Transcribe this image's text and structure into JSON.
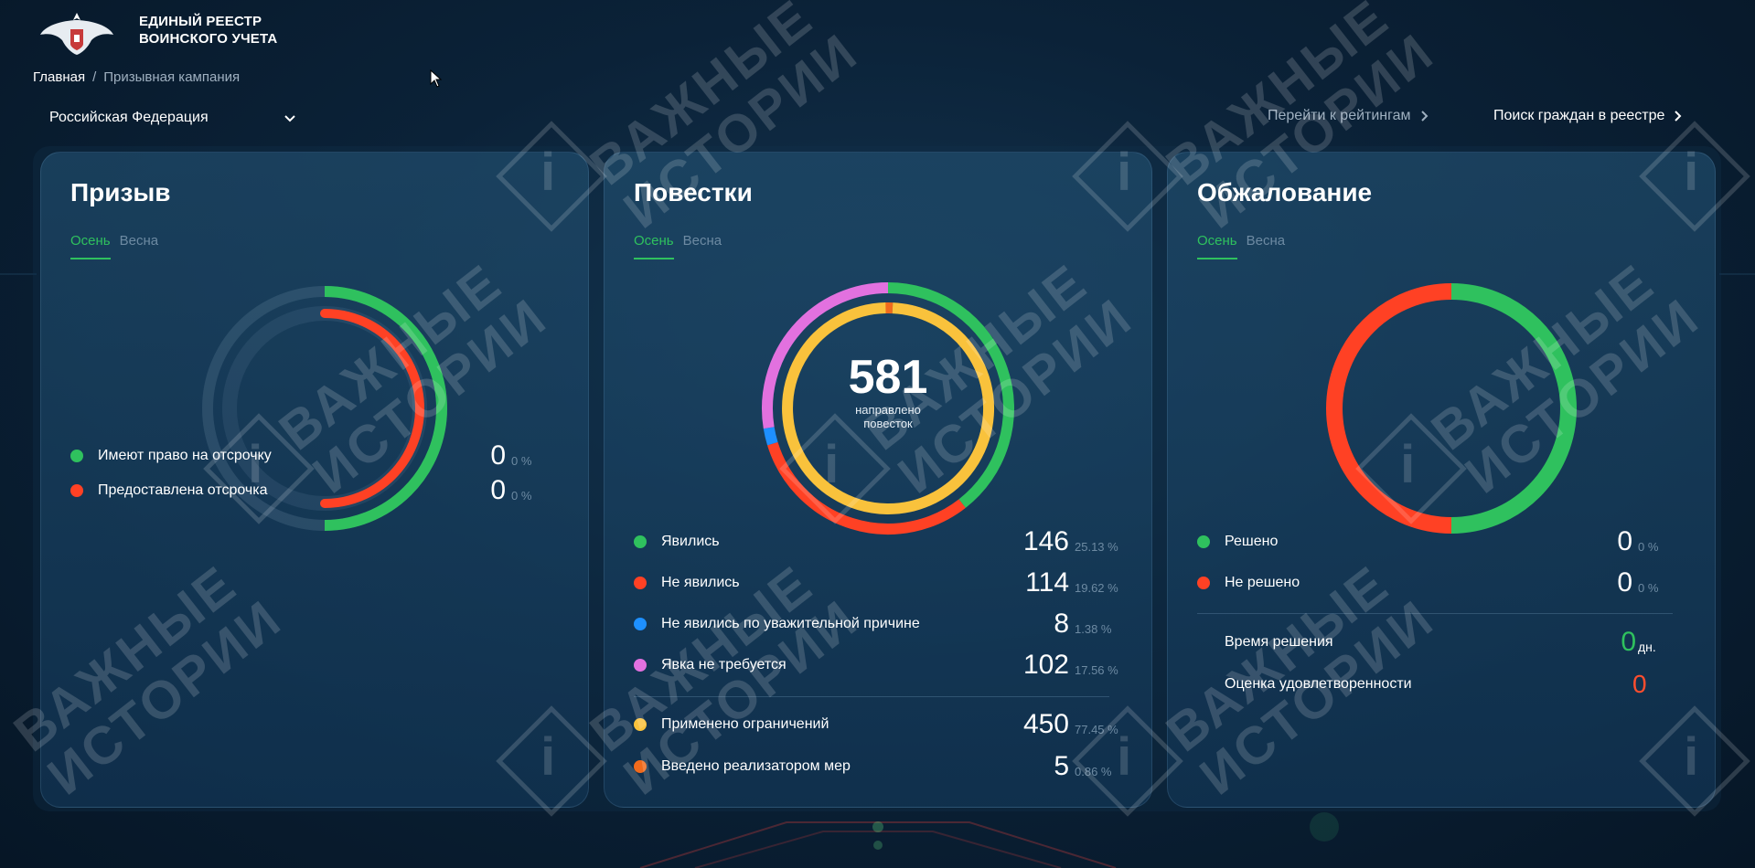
{
  "header": {
    "title_line1": "ЕДИНЫЙ РЕЕСТР",
    "title_line2": "ВОИНСКОГО УЧЕТА"
  },
  "breadcrumb": {
    "home": "Главная",
    "separator": "/",
    "current": "Призывная кампания"
  },
  "region": {
    "selected": "Российская Федерация"
  },
  "top_links": {
    "ratings": "Перейти к рейтингам",
    "search": "Поиск граждан в реестре"
  },
  "colors": {
    "green": "#2fc15e",
    "red": "#ff4124",
    "blue": "#1e90ff",
    "pink": "#e271df",
    "yellow": "#f9c23c",
    "orange": "#f06a1c"
  },
  "watermark": {
    "line1": "ВАЖНЫЕ",
    "line2": "ИСТОРИИ",
    "mark": "i"
  },
  "cards": {
    "draft": {
      "title": "Призыв",
      "tab_active": "Осень",
      "tab_inactive": "Весна",
      "items": [
        {
          "label": "Имеют право на отсрочку",
          "value": "0",
          "pct": "0 %",
          "color": "#2fc15e"
        },
        {
          "label": "Предоставлена отсрочка",
          "value": "0",
          "pct": "0 %",
          "color": "#ff4124"
        }
      ]
    },
    "summons": {
      "title": "Повестки",
      "tab_active": "Осень",
      "tab_inactive": "Весна",
      "center_value": "581",
      "center_label_line1": "направлено",
      "center_label_line2": "повесток",
      "items": [
        {
          "label": "Явились",
          "value": "146",
          "pct": "25.13 %",
          "color": "#2fc15e"
        },
        {
          "label": "Не явились",
          "value": "114",
          "pct": "19.62 %",
          "color": "#ff4124"
        },
        {
          "label": "Не явились по уважительной причине",
          "value": "8",
          "pct": "1.38 %",
          "color": "#1e90ff"
        },
        {
          "label": "Явка не требуется",
          "value": "102",
          "pct": "17.56 %",
          "color": "#e271df"
        }
      ],
      "extra_items": [
        {
          "label": "Применено ограничений",
          "value": "450",
          "pct": "77.45 %",
          "color": "#f9c23c"
        },
        {
          "label": "Введено реализатором мер",
          "value": "5",
          "pct": "0.86 %",
          "color": "#f06a1c"
        }
      ]
    },
    "appeal": {
      "title": "Обжалование",
      "tab_active": "Осень",
      "tab_inactive": "Весна",
      "items": [
        {
          "label": "Решено",
          "value": "0",
          "pct": "0 %",
          "color": "#2fc15e"
        },
        {
          "label": "Не решено",
          "value": "0",
          "pct": "0 %",
          "color": "#ff4124"
        }
      ],
      "time_label": "Время решения",
      "time_value": "0",
      "time_unit": "дн.",
      "rating_label": "Оценка удовлетворенности",
      "rating_value": "0"
    }
  }
}
